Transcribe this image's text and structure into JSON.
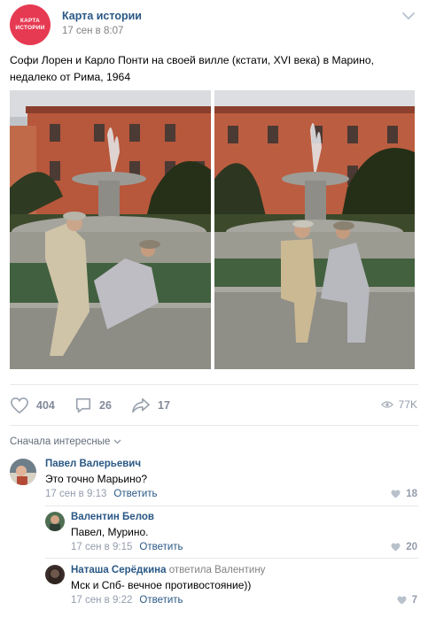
{
  "post": {
    "group_name": "Карта истории",
    "logo_text": [
      "КАРТА",
      "ИСТОРИИ"
    ],
    "date": "17 сен в 8:07",
    "text": "Софи Лорен и Карло Понти на своей вилле (кстати, XVI века) в Марино, недалеко от Рима, 1964"
  },
  "actions": {
    "likes": "404",
    "comments": "26",
    "shares": "17",
    "views": "77K"
  },
  "comments_sort": "Сначала интересные",
  "comments": [
    {
      "author": "Павел Валерьевич",
      "reply_to": "",
      "text": "Это точно Марьино?",
      "date": "17 сен в 9:13",
      "reply_label": "Ответить",
      "likes": "18"
    },
    {
      "author": "Валентин Белов",
      "reply_to": "",
      "text": "Павел, Мурино.",
      "date": "17 сен в 9:15",
      "reply_label": "Ответить",
      "likes": "20"
    },
    {
      "author": "Наташа Серёдкина",
      "reply_to": "ответила Валентину",
      "text": "Мск и Спб- вечное противостояние))",
      "date": "17 сен в 9:22",
      "reply_label": "Ответить",
      "likes": "7"
    }
  ],
  "colors": {
    "brand": "#e63a52",
    "link": "#2a5885",
    "muted": "#828a99",
    "divider": "#e7e8ec"
  },
  "icons": [
    "chevron-down-icon",
    "heart-icon",
    "comment-icon",
    "share-icon",
    "eye-icon"
  ]
}
